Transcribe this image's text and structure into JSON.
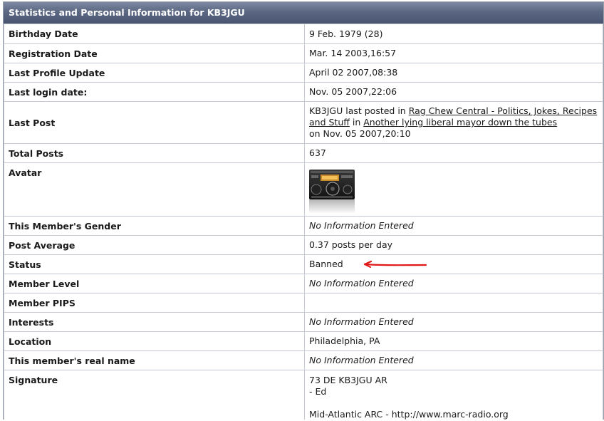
{
  "header": {
    "title": "Statistics and Personal Information for KB3JGU"
  },
  "rows": {
    "birthday": {
      "label": "Birthday Date",
      "value": "9 Feb. 1979 (28)"
    },
    "registration": {
      "label": "Registration Date",
      "value": "Mar. 14 2003,16:57"
    },
    "profile_update": {
      "label": "Last Profile Update",
      "value": "April 02 2007,08:38"
    },
    "last_login": {
      "label": "Last login date:",
      "value": "Nov. 05 2007,22:06"
    },
    "last_post": {
      "label": "Last Post",
      "prefix": "KB3JGU last posted in ",
      "forum_link": "Rag Chew Central - Politics, Jokes, Recipes and Stuff",
      "middle": " in ",
      "topic_link": "Another lying liberal mayor down the tubes",
      "suffix": "on Nov. 05 2007,20:10"
    },
    "total_posts": {
      "label": "Total Posts",
      "value": "637"
    },
    "avatar": {
      "label": "Avatar",
      "icon": "radio-transceiver-icon"
    },
    "gender": {
      "label": "This Member's Gender",
      "value": "No Information Entered"
    },
    "post_average": {
      "label": "Post Average",
      "value": "0.37 posts per day"
    },
    "status": {
      "label": "Status",
      "value": "Banned",
      "annotation_color": "#e01818"
    },
    "member_level": {
      "label": "Member Level",
      "value": "No Information Entered"
    },
    "member_pips": {
      "label": "Member PIPS",
      "value": ""
    },
    "interests": {
      "label": "Interests",
      "value": "No Information Entered"
    },
    "location": {
      "label": "Location",
      "value": "Philadelphia, PA"
    },
    "real_name": {
      "label": "This member's real name",
      "value": "No Information Entered"
    },
    "signature": {
      "label": "Signature",
      "line1": "73 DE KB3JGU AR",
      "line2": "- Ed",
      "line3": "Mid-Atlantic ARC - http://www.marc-radio.org"
    }
  },
  "colors": {
    "header_bg": "#5c6883",
    "border": "#c5c9d1",
    "arrow": "#e01818"
  }
}
